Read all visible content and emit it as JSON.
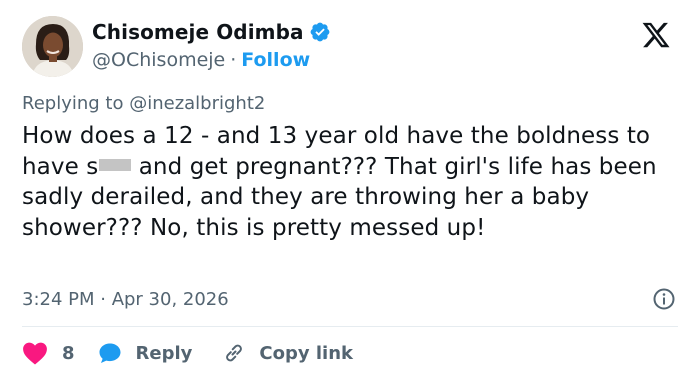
{
  "author": {
    "name": "Chisomeje Odimba",
    "handle": "@OChisomeje",
    "separator": "·",
    "follow_label": "Follow"
  },
  "icons": {
    "verified": "verified-badge-icon",
    "logo": "x-logo-icon",
    "info": "info-icon",
    "like": "heart-icon",
    "reply": "reply-bubble-icon",
    "copy": "link-icon"
  },
  "colors": {
    "accent": "#1d9bf0",
    "secondary_text": "#536471",
    "like": "#f91880",
    "primary_text": "#0f1419"
  },
  "reply_context": {
    "prefix": "Replying to",
    "user": "@inezalbright2"
  },
  "tweet": {
    "text_part1": "How does a 12 - and 13 year old have the boldness to have s",
    "text_part2": " and get pregnant??? That girl's life has been sadly derailed, and they are throwing her a baby shower??? No, this is pretty messed up!"
  },
  "meta": {
    "timestamp": "3:24 PM · Apr 30, 2026"
  },
  "actions": {
    "like_count": "8",
    "reply_label": "Reply",
    "copy_label": "Copy link"
  }
}
